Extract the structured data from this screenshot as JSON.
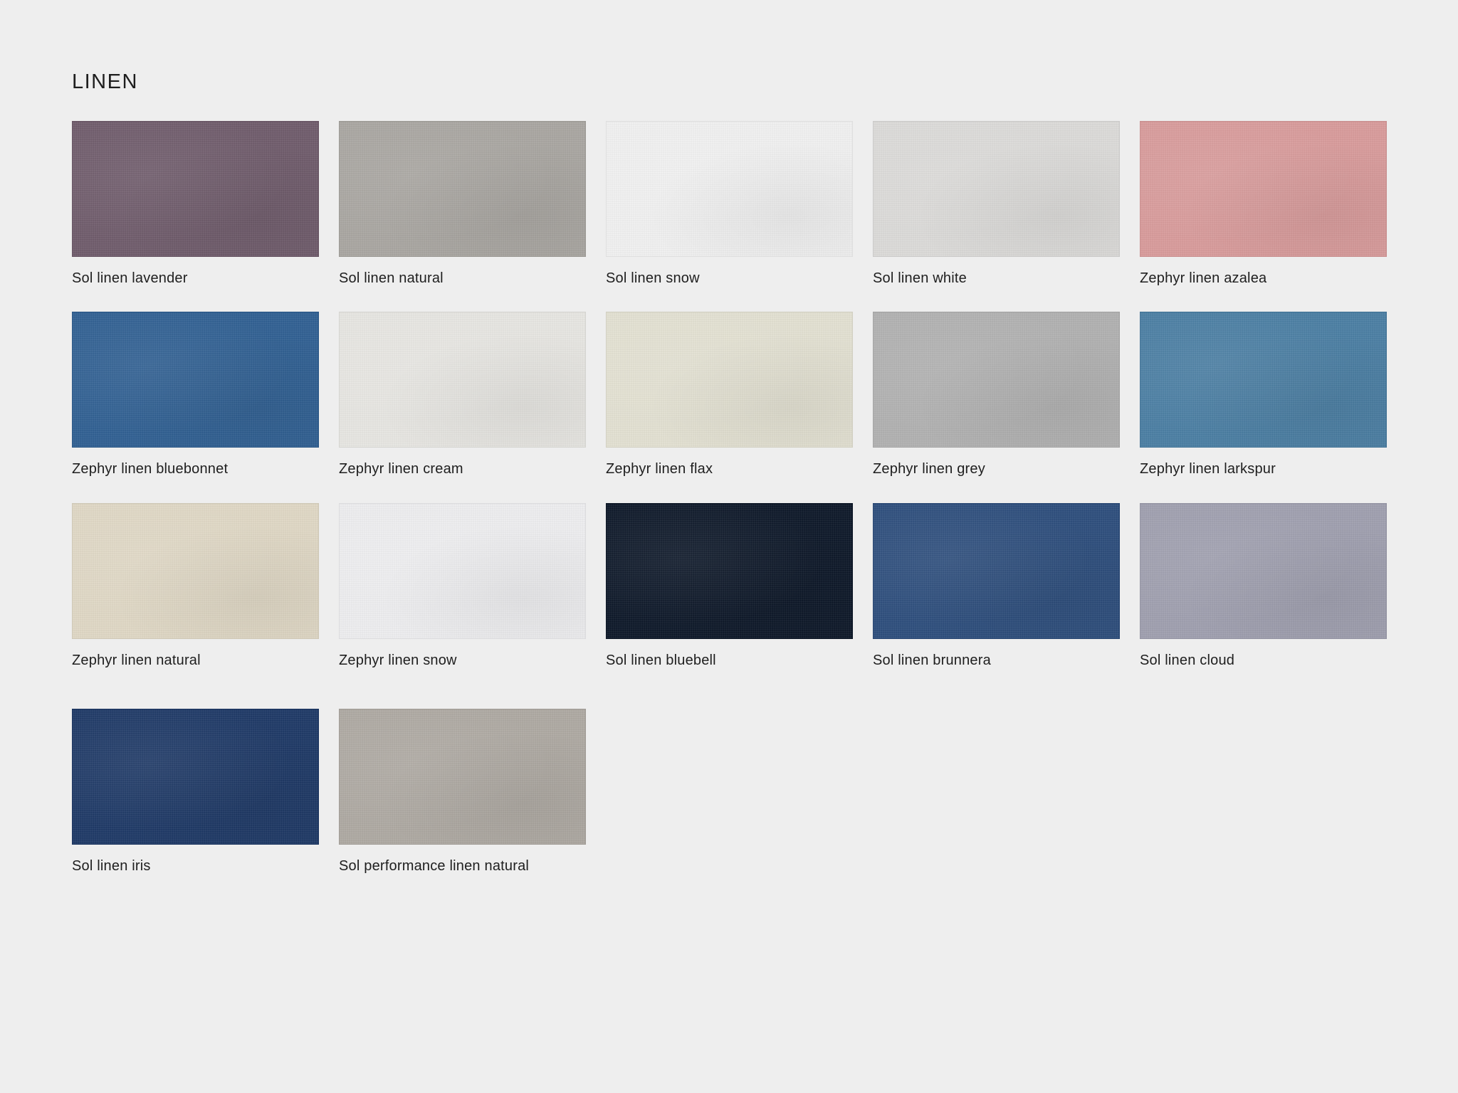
{
  "page": {
    "title": "LINEN"
  },
  "swatches": [
    {
      "label": "Sol linen lavender",
      "color": "#6f5b6b"
    },
    {
      "label": "Sol linen natural",
      "color": "#a9a6a1"
    },
    {
      "label": "Sol linen snow",
      "color": "#f1f1f1"
    },
    {
      "label": "Sol linen white",
      "color": "#dcdbd9"
    },
    {
      "label": "Zephyr linen azalea",
      "color": "#d99b9b"
    },
    {
      "label": "Zephyr linen bluebonnet",
      "color": "#2f5f92"
    },
    {
      "label": "Zephyr linen cream",
      "color": "#e7e6e2"
    },
    {
      "label": "Zephyr linen flax",
      "color": "#e3e1d2"
    },
    {
      "label": "Zephyr linen grey",
      "color": "#b1b1b1"
    },
    {
      "label": "Zephyr linen larkspur",
      "color": "#4a7ea3"
    },
    {
      "label": "Zephyr linen natural",
      "color": "#e0d8c5"
    },
    {
      "label": "Zephyr linen snow",
      "color": "#eeeef0"
    },
    {
      "label": "Sol linen bluebell",
      "color": "#0c1728"
    },
    {
      "label": "Sol linen brunnera",
      "color": "#2c4d7c"
    },
    {
      "label": "Sol linen cloud",
      "color": "#9f9faf"
    },
    {
      "label": "Sol linen iris",
      "color": "#1d3866"
    },
    {
      "label": "Sol performance linen natural",
      "color": "#aea9a2"
    }
  ]
}
